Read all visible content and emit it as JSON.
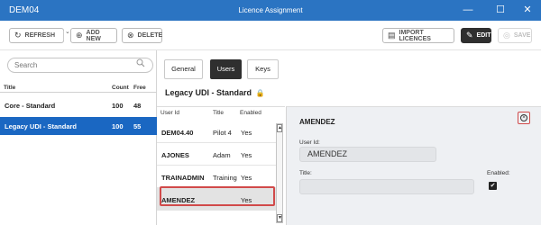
{
  "window": {
    "app_name": "DEM04",
    "title": "Licence Assignment",
    "minimize_glyph": "—",
    "maximize_glyph": "☐",
    "close_glyph": "✕"
  },
  "toolbar": {
    "refresh_label": "REFRESH",
    "refresh_dropdown_glyph": "⌄",
    "add_new_label": "ADD NEW",
    "delete_label": "DELETE",
    "import_label": "IMPORT LICENCES",
    "edit_label": "EDIT",
    "save_label": "SAVE"
  },
  "icons": {
    "refresh": "↻",
    "add": "⊕",
    "delete": "⊗",
    "import": "▤",
    "edit": "✎",
    "save": "◎",
    "search": "🔍",
    "lock": "🔒",
    "close": "×",
    "check": "✔",
    "scroll_up": "▲",
    "scroll_down": "▼"
  },
  "search": {
    "placeholder": "Search"
  },
  "licences": {
    "columns": {
      "title": "Title",
      "count": "Count",
      "free": "Free"
    },
    "rows": [
      {
        "title": "Core - Standard",
        "count": "100",
        "free": "48",
        "selected": false
      },
      {
        "title": "Legacy UDI - Standard",
        "count": "100",
        "free": "55",
        "selected": true
      }
    ]
  },
  "tabs": [
    {
      "label": "General",
      "active": false
    },
    {
      "label": "Users",
      "active": true
    },
    {
      "label": "Keys",
      "active": false
    }
  ],
  "panel_title": "Legacy UDI - Standard",
  "users": {
    "columns": {
      "user_id": "User Id",
      "title": "Title",
      "enabled": "Enabled"
    },
    "rows": [
      {
        "user_id": "DEM04.40",
        "title": "Pilot 4",
        "enabled": "Yes",
        "highlighted": false
      },
      {
        "user_id": "AJONES",
        "title": "Adam",
        "enabled": "Yes",
        "highlighted": false
      },
      {
        "user_id": "TRAINADMIN",
        "title": "Training",
        "enabled": "Yes",
        "highlighted": false
      },
      {
        "user_id": "AMENDEZ",
        "title": "",
        "enabled": "Yes",
        "highlighted": true
      }
    ]
  },
  "detail": {
    "heading": "AMENDEZ",
    "user_id_label": "User Id:",
    "user_id_value": "AMENDEZ",
    "title_label": "Title:",
    "title_value": "",
    "enabled_label": "Enabled:",
    "enabled_checked": true
  },
  "colors": {
    "title_bar": "#2b74c2",
    "selection": "#1a67c2",
    "active_tab": "#2f2f2f",
    "highlight_outline": "#d14a4a",
    "detail_background": "#eef0f3"
  }
}
